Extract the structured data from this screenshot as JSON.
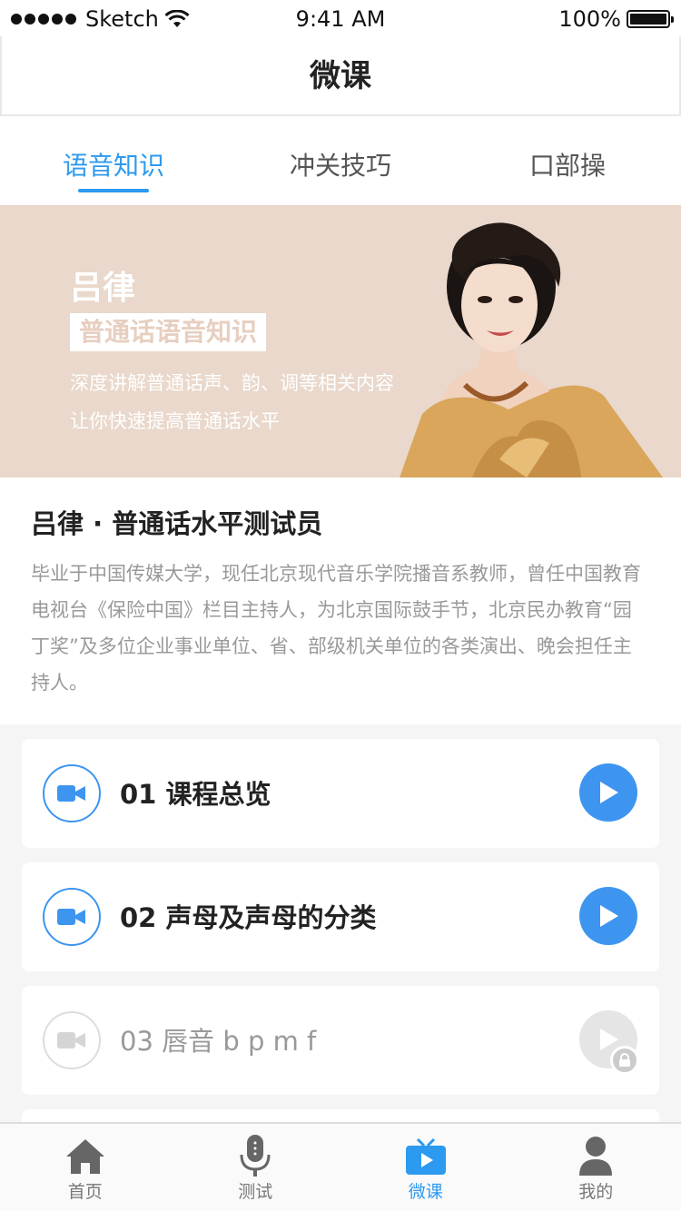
{
  "status_bar": {
    "carrier": "Sketch",
    "time": "9:41 AM",
    "battery": "100%"
  },
  "nav": {
    "title": "微课"
  },
  "tabs": [
    {
      "label": "语音知识",
      "active": true
    },
    {
      "label": "冲关技巧",
      "active": false
    },
    {
      "label": "口部操",
      "active": false
    }
  ],
  "banner": {
    "name": "吕律",
    "tag": "普通话语音知识",
    "desc_line1": "深度讲解普通话声、韵、调等相关内容",
    "desc_line2": "让你快速提高普通话水平"
  },
  "intro": {
    "title": "吕律 · 普通话水平测试员",
    "body": "毕业于中国传媒大学，现任北京现代音乐学院播音系教师，曾任中国教育电视台《保险中国》栏目主持人，为北京国际鼓手节，北京民办教育“园丁奖”及多位企业事业单位、省、部级机关单位的各类演出、晚会担任主持人。"
  },
  "lessons": [
    {
      "title": "01 课程总览",
      "locked": false
    },
    {
      "title": "02 声母及声母的分类",
      "locked": false
    },
    {
      "title": "03 唇音 b p m f",
      "locked": true
    }
  ],
  "tabbar": [
    {
      "label": "首页",
      "icon": "home-icon",
      "active": false
    },
    {
      "label": "测试",
      "icon": "microphone-icon",
      "active": false
    },
    {
      "label": "微课",
      "icon": "tv-icon",
      "active": true
    },
    {
      "label": "我的",
      "icon": "person-icon",
      "active": false
    }
  ],
  "colors": {
    "accent": "#2c9af0",
    "banner_bg": "#e9d8cb",
    "play_blue": "#3d95f0",
    "muted": "#999999"
  }
}
